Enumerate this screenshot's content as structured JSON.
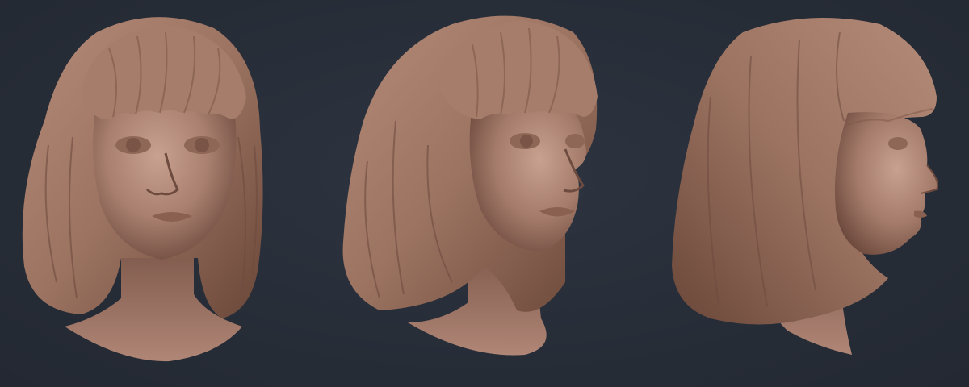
{
  "scene": {
    "background_color": "#272d38",
    "clay_color": "#a9806f",
    "clay_shadow_color": "#6e4b3f",
    "clay_highlight_color": "#c9a190",
    "views": [
      {
        "name": "front-view"
      },
      {
        "name": "three-quarter-view"
      },
      {
        "name": "profile-view"
      }
    ]
  }
}
